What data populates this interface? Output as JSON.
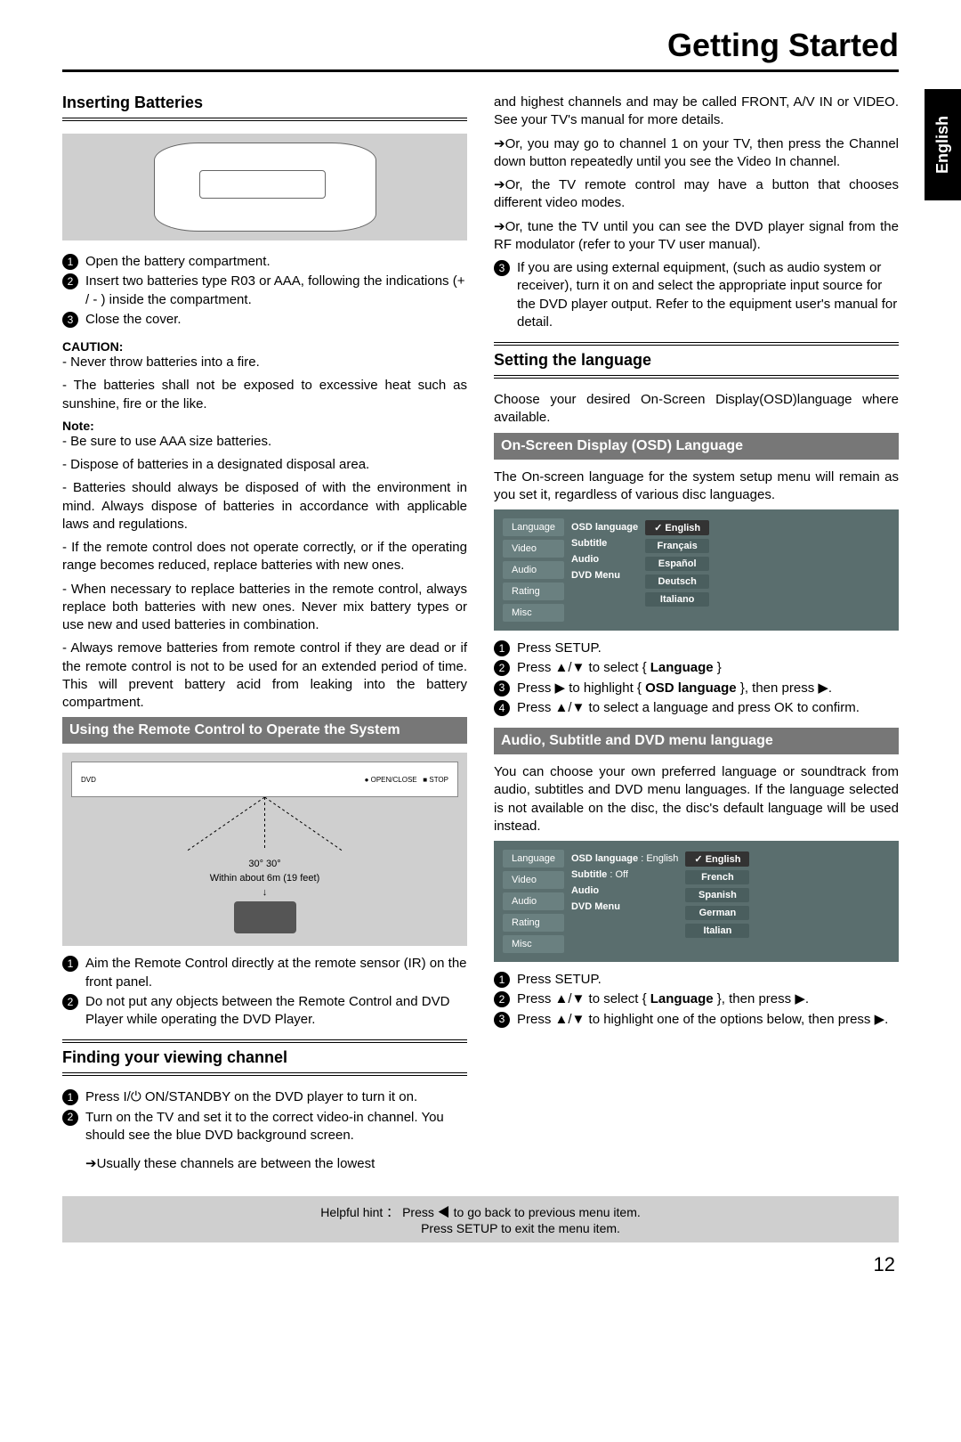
{
  "page_title": "Getting Started",
  "language_tab": "English",
  "page_number": "12",
  "left": {
    "sec1_heading": "Inserting Batteries",
    "sec1_steps": [
      "Open the battery compartment.",
      "Insert two batteries type R03 or AAA, following the indications (+ / - ) inside the compartment.",
      "Close the cover."
    ],
    "caution_label": "CAUTION:",
    "caution_lines": [
      "- Never throw batteries into a fire.",
      "- The batteries shall not be exposed to excessive heat such as sunshine, fire or the like."
    ],
    "note_label": "Note:",
    "note_lines": [
      "- Be sure to use AAA size batteries.",
      "- Dispose of batteries in a designated disposal area.",
      "- Batteries should always be disposed of with the environment in mind. Always dispose of batteries in accordance with applicable laws and regulations.",
      "- If the remote control does not operate correctly, or if the operating range becomes reduced, replace batteries with new ones.",
      "- When necessary to replace batteries in the remote control, always replace both batteries with new ones. Never mix battery types or use new and used batteries in combination.",
      "- Always remove batteries from remote control if they are dead or if the remote control is not to be used for an extended period of time. This will prevent battery acid from leaking into the battery compartment."
    ],
    "sec2_heading": "Using the Remote Control to Operate the System",
    "remote_angle": "30°   30°",
    "remote_range": "Within about 6m (19 feet)",
    "sec2_steps": [
      "Aim the Remote Control directly at the remote sensor (IR) on the front panel.",
      "Do not put any objects between the Remote Control and DVD Player while operating the DVD Player."
    ],
    "sec3_heading": "Finding your viewing channel",
    "sec3_steps": [
      "Press I/⏻ ON/STANDBY on the DVD player to turn it on.",
      "Turn on the TV and set it to the correct video-in channel. You should see the blue DVD background screen."
    ],
    "sec3_sub": "➔Usually these channels are between the lowest"
  },
  "right": {
    "cont1": "and highest channels and may be called FRONT, A/V IN or VIDEO. See your TV's manual for more details.",
    "cont2": "➔Or, you may go to channel 1 on your TV, then press the Channel down button repeatedly until you see the Video In channel.",
    "cont3": "➔Or, the TV remote control may have a button that chooses different video modes.",
    "cont4": "➔Or, tune the TV until you can see the DVD player signal from the RF modulator (refer to your TV user manual).",
    "step3": "If you are using external equipment, (such as audio system or receiver), turn it on and select the appropriate input source for the DVD player output. Refer to the equipment user's manual for detail.",
    "sec4_heading": "Setting the language",
    "sec4_intro": "Choose your desired On-Screen Display(OSD)language where available.",
    "sec5_heading": "On-Screen Display (OSD) Language",
    "sec5_intro": "The On-screen language for the system setup menu will remain as you set it, regardless of various disc languages.",
    "osd1": {
      "left": [
        "Language",
        "Video",
        "Audio",
        "Rating",
        "Misc"
      ],
      "mid": [
        "OSD language",
        "Subtitle",
        "Audio",
        "DVD Menu"
      ],
      "right": [
        "English",
        "Français",
        "Español",
        "Deutsch",
        "Italiano"
      ]
    },
    "sec5_steps_pre": [
      "Press SETUP."
    ],
    "sec5_step2_a": "Press ▲/▼ to select { ",
    "sec5_step2_b": "Language",
    "sec5_step2_c": " }",
    "sec5_step3_a": "Press ▶ to highlight { ",
    "sec5_step3_b": "OSD language",
    "sec5_step3_c": " }, then press ▶.",
    "sec5_step4": "Press ▲/▼ to select a language and press OK to confirm.",
    "sec6_heading": "Audio, Subtitle and DVD menu language",
    "sec6_intro": "You can choose your own preferred language or soundtrack from audio, subtitles and DVD menu languages. If the language selected is not available on the disc, the disc's default language will be used instead.",
    "osd2": {
      "left": [
        "Language",
        "Video",
        "Audio",
        "Rating",
        "Misc"
      ],
      "mid_labels": [
        "OSD language",
        "Subtitle",
        "Audio",
        "DVD Menu"
      ],
      "mid_vals": [
        ": English",
        ": Off"
      ],
      "right": [
        "English",
        "French",
        "Spanish",
        "German",
        "Italian"
      ]
    },
    "sec6_step1": "Press SETUP.",
    "sec6_step2_a": "Press ▲/▼ to select { ",
    "sec6_step2_b": "Language",
    "sec6_step2_c": " }, then press ▶.",
    "sec6_step3": "Press ▲/▼ to highlight one of the options below, then press ▶."
  },
  "footer": {
    "line1": "Helpful hint ： Press ◀ to go back to previous menu item.",
    "line2": "Press SETUP to exit the menu item."
  }
}
